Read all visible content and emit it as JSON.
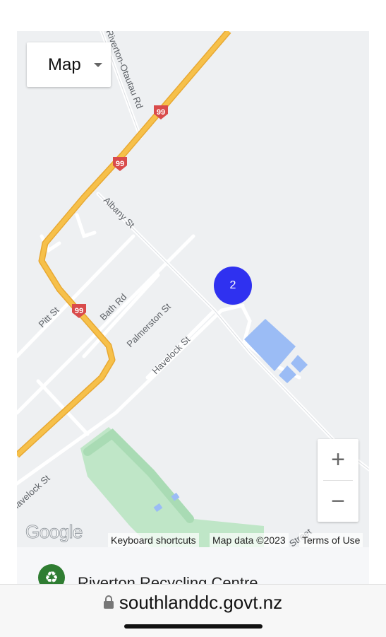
{
  "map": {
    "type_label": "Map",
    "cluster_count": "2",
    "roads": {
      "riverton_otautau": "Riverton-Otautau Rd",
      "albany": "Albany St",
      "pitt": "Pitt St",
      "bath": "Bath Rd",
      "palmerston": "Palmerston St",
      "havelock": "Havelock St",
      "havelock_lower": "Havelock St",
      "street_partial": "Street"
    },
    "highway_shield": "99",
    "zoom_in": "+",
    "zoom_out": "−",
    "google_logo": "Google",
    "keyboard_shortcuts": "Keyboard shortcuts",
    "map_data": "Map data ©2023",
    "terms": "Terms of Use",
    "colors": {
      "highway": "#f6c04a",
      "cluster": "#2f31f0",
      "park": "#bfe6c7",
      "facility": "#9bbcf5"
    }
  },
  "list": {
    "first_item": "Riverton Recycling Centre"
  },
  "browser": {
    "url": "southlanddc.govt.nz"
  }
}
